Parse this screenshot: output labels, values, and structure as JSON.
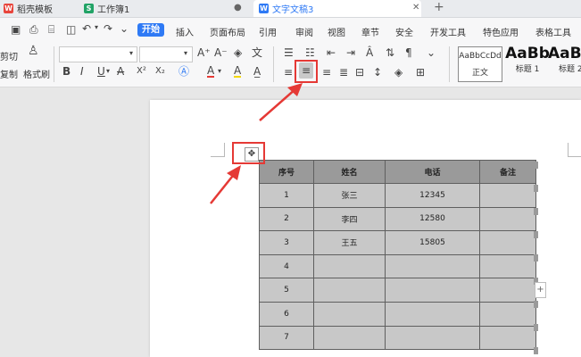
{
  "tabs": [
    {
      "label": "稻壳模板",
      "icon_color": "#e8453c",
      "icon_glyph": "W"
    },
    {
      "label": "工作簿1",
      "icon_color": "#21a366",
      "icon_glyph": "S"
    },
    {
      "label": "文字文稿3",
      "icon_color": "#2f7af5",
      "icon_glyph": "W"
    }
  ],
  "tab_add": "+",
  "menu": {
    "start": "开始",
    "items": [
      "插入",
      "页面布局",
      "引用",
      "审阅",
      "视图",
      "章节",
      "安全",
      "开发工具",
      "特色应用",
      "表格工具"
    ]
  },
  "ribbon": {
    "cut": "剪切",
    "copy": "复制",
    "format_painter": "格式刷",
    "bold": "B",
    "italic": "I",
    "underline": "U",
    "strike": "A",
    "superscript": "X²",
    "subscript": "X₂",
    "font_color": "A",
    "highlight": "A",
    "styles": [
      {
        "preview": "AaBbCcDd",
        "name": "正文"
      },
      {
        "preview": "AaBb",
        "name": "标题 1"
      },
      {
        "preview": "AaBl",
        "name": "标题 2"
      }
    ]
  },
  "table": {
    "headers": [
      "序号",
      "姓名",
      "电话",
      "备注"
    ],
    "rows": [
      [
        "1",
        "张三",
        "12345",
        ""
      ],
      [
        "2",
        "李四",
        "12580",
        ""
      ],
      [
        "3",
        "王五",
        "15805",
        ""
      ],
      [
        "4",
        "",
        "",
        ""
      ],
      [
        "5",
        "",
        "",
        ""
      ],
      [
        "6",
        "",
        "",
        ""
      ],
      [
        "7",
        "",
        "",
        ""
      ]
    ]
  },
  "colors": {
    "accent": "#2f7af5",
    "annotation": "#e53935"
  }
}
